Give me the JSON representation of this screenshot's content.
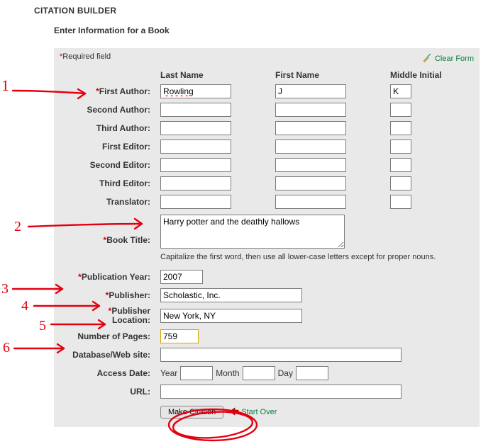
{
  "heading": "CITATION BUILDER",
  "subheading": "Enter Information for a Book",
  "required_note": "Required field",
  "clear_form": "Clear Form",
  "columns": {
    "last": "Last Name",
    "first": "First Name",
    "mid": "Middle Initial"
  },
  "rows": {
    "first_author": {
      "label": "First Author:",
      "required": true,
      "last": "Rowling",
      "first": "J",
      "mid": "K"
    },
    "second_author": {
      "label": "Second Author:",
      "last": "",
      "first": "",
      "mid": ""
    },
    "third_author": {
      "label": "Third Author:",
      "last": "",
      "first": "",
      "mid": ""
    },
    "first_editor": {
      "label": "First Editor:",
      "last": "",
      "first": "",
      "mid": ""
    },
    "second_editor": {
      "label": "Second Editor:",
      "last": "",
      "first": "",
      "mid": ""
    },
    "third_editor": {
      "label": "Third Editor:",
      "last": "",
      "first": "",
      "mid": ""
    },
    "translator": {
      "label": "Translator:",
      "last": "",
      "first": "",
      "mid": ""
    }
  },
  "book_title": {
    "label": "Book Title:",
    "required": true,
    "value": "Harry potter and the deathly hallows",
    "hint": "Capitalize the first word, then use all lower-case letters except for proper nouns."
  },
  "pub_year": {
    "label": "Publication Year:",
    "required": true,
    "value": "2007"
  },
  "publisher": {
    "label": "Publisher:",
    "required": true,
    "value": "Scholastic, Inc."
  },
  "pub_loc": {
    "label": "Publisher Location:",
    "required": true,
    "value": "New York, NY"
  },
  "num_pages": {
    "label": "Number of Pages:",
    "value": "759"
  },
  "db_site": {
    "label": "Database/Web site:",
    "value": ""
  },
  "access_date": {
    "label": "Access Date:",
    "year_lbl": "Year",
    "month_lbl": "Month",
    "day_lbl": "Day",
    "year": "",
    "month": "",
    "day": ""
  },
  "url": {
    "label": "URL:",
    "value": ""
  },
  "make_btn": "Make Citation",
  "start_over": "Start Over",
  "anno": {
    "n1": "1",
    "n2": "2",
    "n3": "3",
    "n4": "4",
    "n5": "5",
    "n6": "6"
  }
}
